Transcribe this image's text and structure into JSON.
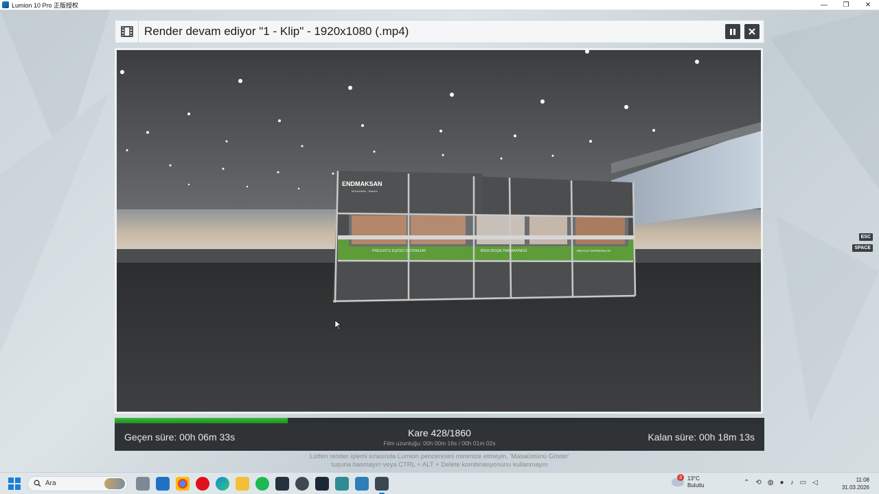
{
  "app": {
    "title": "Lumion 10 Pro 正版授权",
    "minimize": "—",
    "restore": "❐",
    "close": "✕"
  },
  "render": {
    "title": "Render devam ediyor \"1 - Klip\" - 1920x1080 (.mp4)",
    "pause_icon": "pause-icon",
    "close_icon": "close-icon",
    "progress": 0.2667,
    "elapsed": "Geçen süre: 00h 06m 33s",
    "frame": "Kare 428/1860",
    "film_length": "Film uzunluğu: 00h 00m 16s / 00h 01m 02s",
    "remaining": "Kalan süre: 00h 18m 13s"
  },
  "scene": {
    "logo_text": "ENDMAKSAN",
    "logo_sub": "Mühendislik · Makina",
    "panel_texts": [
      "PRESUSTU EŞZGIZ SİSTEMLERİ",
      "BİGGI BOŞALTMA MAKİNESİ",
      "MEVCUT EKİPMANLAR"
    ]
  },
  "hints": {
    "esc": "ESC",
    "space": "SPACE"
  },
  "warning": {
    "line1": "Lütfen render işlemi sırasında Lumion penceresini minimize etmeyin, 'Masaüstünü Göster'",
    "line2": "tuşuna basmayın veya CTRL + ALT + Delete kombinasyonunu kullanmayın"
  },
  "taskbar": {
    "search_placeholder": "Ara",
    "weather_badge": "3",
    "temperature": "13°C",
    "weather_condition": "Bulutlu",
    "time": "11:08",
    "date": "31.03.2026"
  }
}
